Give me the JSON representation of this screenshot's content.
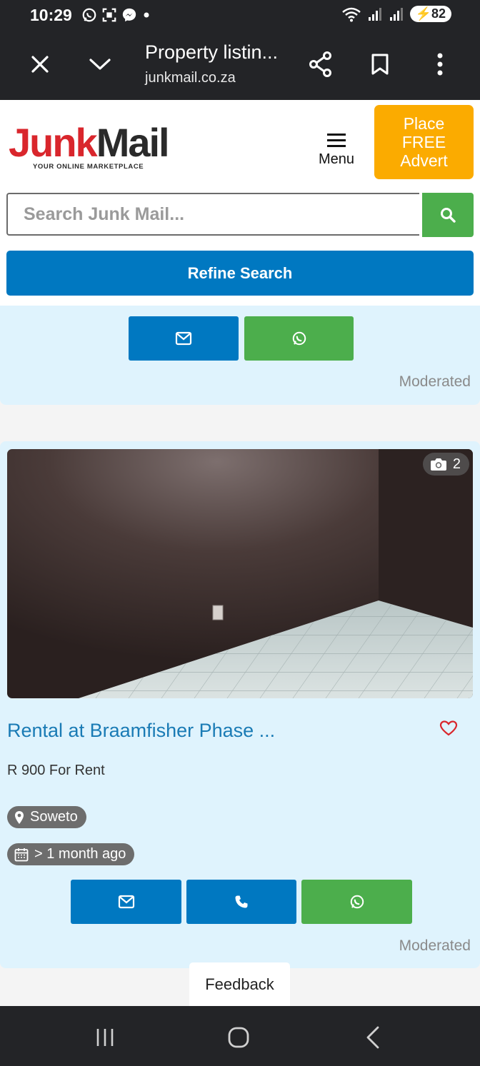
{
  "status_bar": {
    "time": "10:29",
    "battery": "82"
  },
  "browser": {
    "page_title": "Property listin...",
    "domain": "junkmail.co.za"
  },
  "site": {
    "logo_part1": "Junk",
    "logo_part2": "Mail",
    "logo_tagline": "YOUR ONLINE MARKETPLACE",
    "menu_label": "Menu",
    "place_advert_lines": [
      "Place",
      "FREE",
      "Advert"
    ],
    "search_placeholder": "Search Junk Mail...",
    "refine_label": "Refine Search"
  },
  "listings": [
    {
      "moderated": "Moderated"
    },
    {
      "photo_count": "2",
      "title": "Rental at Braamfisher Phase ...",
      "price": "R 900 For Rent",
      "location": "Soweto",
      "posted": "> 1 month ago",
      "moderated": "Moderated"
    }
  ],
  "feedback_label": "Feedback",
  "colors": {
    "brand_red": "#d9262c",
    "primary_blue": "#0078c1",
    "whatsapp_green": "#4cae4c",
    "advert_orange": "#fbab00",
    "card_bg": "#dff3fd"
  }
}
